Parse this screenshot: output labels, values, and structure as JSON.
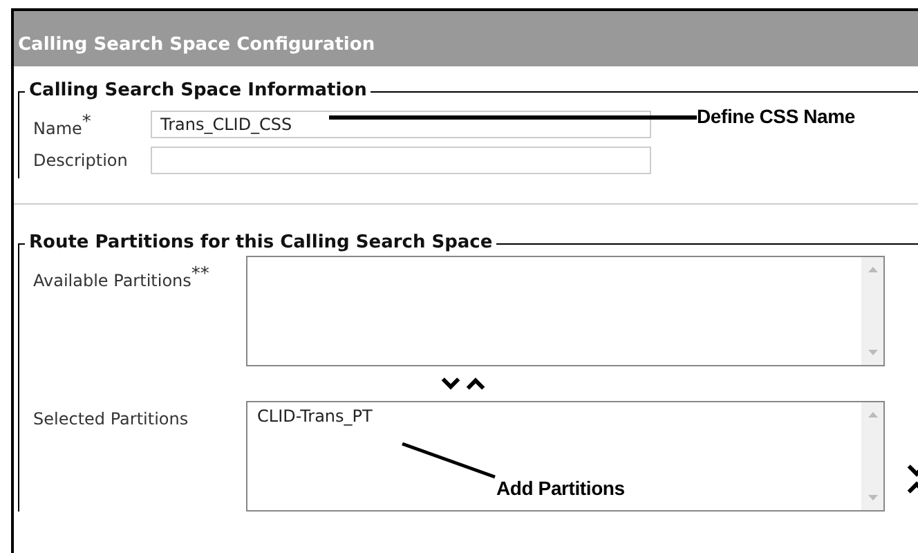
{
  "window": {
    "title": "Calling Search Space Configuration"
  },
  "info_section": {
    "legend": "Calling Search Space Information",
    "fields": [
      {
        "label": "Name",
        "required_mark": "*",
        "value": "Trans_CLID_CSS"
      },
      {
        "label": "Description"
      }
    ]
  },
  "partitions_section": {
    "legend": "Route Partitions for this Calling Search Space",
    "available": {
      "label": "Available Partitions",
      "required_mark": "**"
    },
    "selected": {
      "label": "Selected Partitions",
      "items": [
        "CLID-Trans_PT"
      ]
    }
  },
  "annotations": [
    {
      "text": "Define CSS Name"
    },
    {
      "text": "Add Partitions"
    }
  ]
}
